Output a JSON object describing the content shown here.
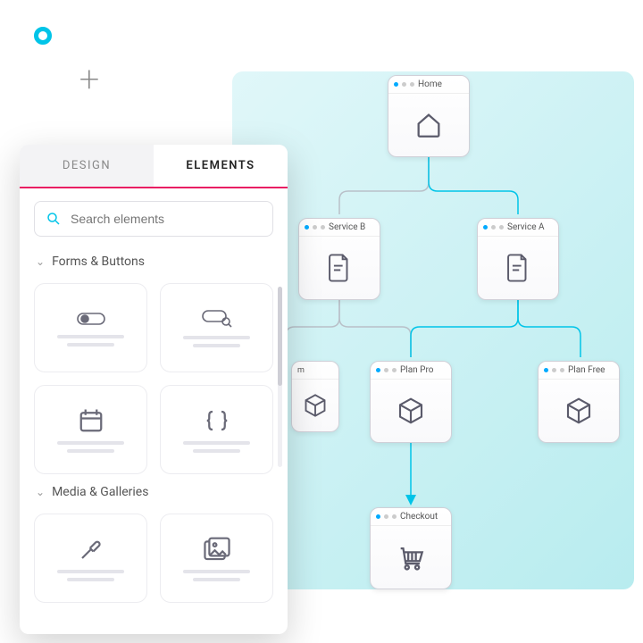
{
  "tabs": {
    "design": "DESIGN",
    "elements": "ELEMENTS"
  },
  "search": {
    "placeholder": "Search elements"
  },
  "sections": {
    "forms": "Forms & Buttons",
    "media": "Media & Galleries"
  },
  "nodes": {
    "home": "Home",
    "serviceA": "Service A",
    "serviceB": "Service B",
    "planPro": "Plan Pro",
    "planFree": "Plan Free",
    "planM": "m",
    "checkout": "Checkout"
  }
}
